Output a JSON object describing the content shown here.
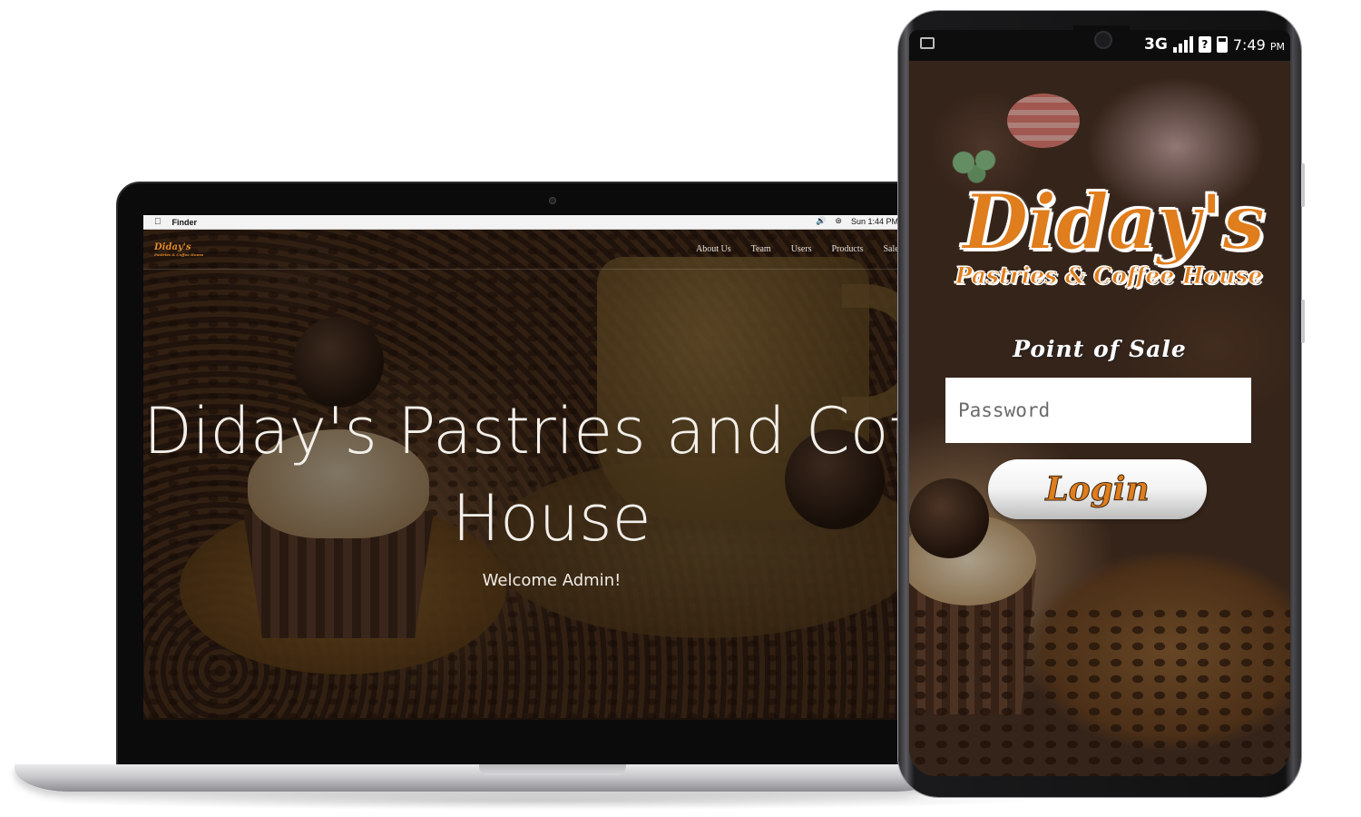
{
  "laptop": {
    "mac_menubar": {
      "app_name": "Finder",
      "clock": "Sun 1:44 PM"
    },
    "website": {
      "nav_items": [
        "About Us",
        "Team",
        "Users",
        "Products",
        "Sales"
      ],
      "hero_title_line1": "Diday's Pastries and Coffee",
      "hero_title_line2": "House",
      "hero_subtitle": "Welcome Admin!",
      "logo_text": "Diday's",
      "logo_subtext": "Pastries & Coffee House"
    }
  },
  "phone": {
    "status_bar": {
      "network": "3G",
      "time": "7:49",
      "time_suffix": "PM"
    },
    "brand_name": "Diday's",
    "brand_tagline": "Pastries & Coffee House",
    "screen_title": "Point of Sale",
    "password_placeholder": "Password",
    "login_label": "Login"
  },
  "colors": {
    "brand_orange": "#e07d1c",
    "overlay": "#000000"
  }
}
